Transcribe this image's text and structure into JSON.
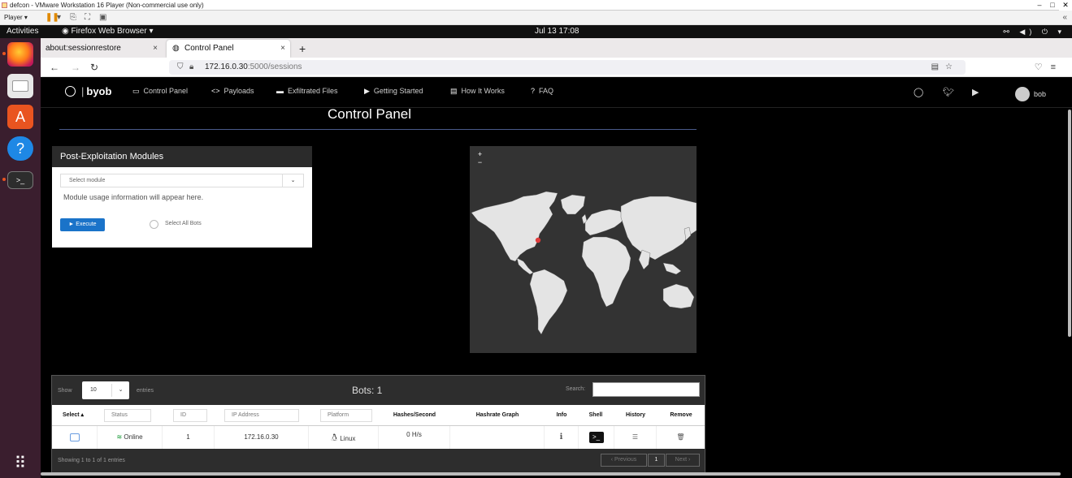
{
  "vm": {
    "title": "defcon - VMware Workstation 16 Player (Non-commercial use only)",
    "player_label": "Player ▾",
    "win_controls": [
      "–",
      "□",
      "✕"
    ]
  },
  "gnome": {
    "activities": "Activities",
    "app_menu": "Firefox Web Browser ▾",
    "clock": "Jul 13  17:08",
    "tray": "⚯ ◀) ⏻ ▾"
  },
  "browser": {
    "tabs": [
      {
        "label": "about:sessionrestore",
        "active": false
      },
      {
        "label": "Control Panel",
        "active": true
      }
    ],
    "new_tab": "+",
    "url_host": "172.16.0.30",
    "url_path": ":5000/sessions"
  },
  "navbar": {
    "brand": "byob",
    "items": [
      {
        "icon": "▭",
        "label": "Control Panel"
      },
      {
        "icon": "<>",
        "label": "Payloads"
      },
      {
        "icon": "▬",
        "label": "Exfiltrated Files"
      },
      {
        "icon": "▶",
        "label": "Getting Started"
      },
      {
        "icon": "▤",
        "label": "How It Works"
      },
      {
        "icon": "?",
        "label": "FAQ"
      }
    ],
    "user": "bob"
  },
  "main": {
    "title": "Control Panel"
  },
  "modules": {
    "header": "Post-Exploitation Modules",
    "select_placeholder": "Select module",
    "info": "Module usage information will appear here.",
    "execute_label": "► Execute",
    "select_all_label": "Select All Bots"
  },
  "map": {
    "zoom_in": "+",
    "zoom_out": "−",
    "marker_color": "#e03c3c"
  },
  "table": {
    "show_label": "Show",
    "length": "10",
    "entries_label": "entries",
    "bots_title": "Bots: 1",
    "search_label": "Search:",
    "columns": {
      "select": "Select ▴",
      "status": "Status",
      "id": "ID",
      "ip": "IP Address",
      "platform": "Platform",
      "hashes": "Hashes/Second",
      "graph": "Hashrate Graph",
      "info": "Info",
      "shell": "Shell",
      "history": "History",
      "remove": "Remove"
    },
    "rows": [
      {
        "status": "Online",
        "id": "1",
        "ip": "172.16.0.30",
        "platform": "Linux",
        "hashes": "0 H/s"
      }
    ],
    "footer_info": "Showing 1 to 1 of 1 entries",
    "pagination": {
      "prev": "Previous",
      "page": "1",
      "next": "Next"
    }
  },
  "colors": {
    "accent": "#1a73c9",
    "online": "#1d9b3a",
    "dock": "#3a1e2e"
  }
}
